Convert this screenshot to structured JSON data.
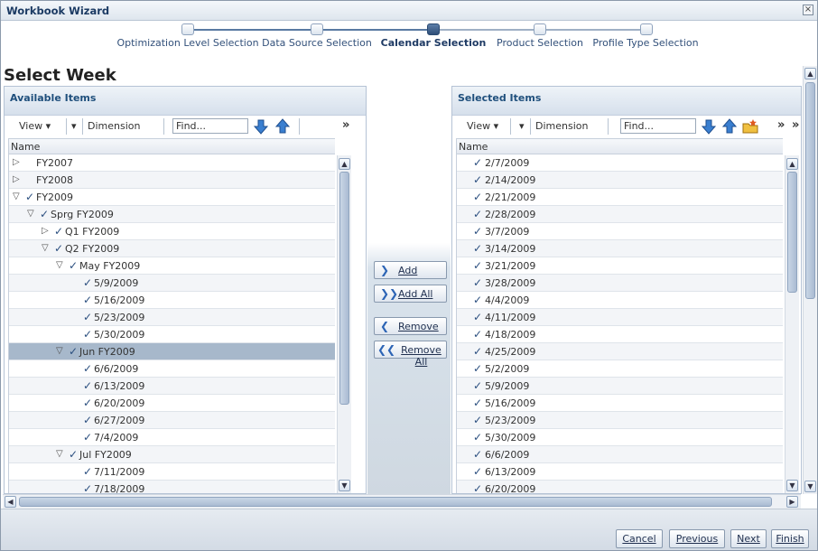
{
  "window": {
    "title": "Workbook Wizard",
    "close_glyph": "×"
  },
  "train": {
    "steps": [
      {
        "label": "Optimization Level Selection"
      },
      {
        "label": "Data Source Selection"
      },
      {
        "label": "Calendar Selection"
      },
      {
        "label": "Product Selection"
      },
      {
        "label": "Profile Type Selection"
      }
    ],
    "current_index": 2
  },
  "page_title": "Select Week",
  "available": {
    "header": "Available Items",
    "toolbar": {
      "view_label": "View ▾",
      "dimension_label": "Dimension",
      "find_placeholder": "Find...",
      "overflow": "»"
    },
    "column_header": "Name",
    "rows": [
      {
        "label": "FY2007",
        "twisty": "▷",
        "checked": false,
        "level": 0
      },
      {
        "label": "FY2008",
        "twisty": "▷",
        "checked": false,
        "level": 0
      },
      {
        "label": "FY2009",
        "twisty": "▽",
        "checked": true,
        "level": 0
      },
      {
        "label": "Sprg FY2009",
        "twisty": "▽",
        "checked": true,
        "level": 1
      },
      {
        "label": "Q1 FY2009",
        "twisty": "▷",
        "checked": true,
        "level": 2
      },
      {
        "label": "Q2 FY2009",
        "twisty": "▽",
        "checked": true,
        "level": 2
      },
      {
        "label": "May FY2009",
        "twisty": "▽",
        "checked": true,
        "level": 3
      },
      {
        "label": "5/9/2009",
        "twisty": "",
        "checked": true,
        "level": 4
      },
      {
        "label": "5/16/2009",
        "twisty": "",
        "checked": true,
        "level": 4
      },
      {
        "label": "5/23/2009",
        "twisty": "",
        "checked": true,
        "level": 4
      },
      {
        "label": "5/30/2009",
        "twisty": "",
        "checked": true,
        "level": 4
      },
      {
        "label": "Jun FY2009",
        "twisty": "▽",
        "checked": true,
        "level": 3,
        "selected": true
      },
      {
        "label": "6/6/2009",
        "twisty": "",
        "checked": true,
        "level": 4
      },
      {
        "label": "6/13/2009",
        "twisty": "",
        "checked": true,
        "level": 4
      },
      {
        "label": "6/20/2009",
        "twisty": "",
        "checked": true,
        "level": 4
      },
      {
        "label": "6/27/2009",
        "twisty": "",
        "checked": true,
        "level": 4
      },
      {
        "label": "7/4/2009",
        "twisty": "",
        "checked": true,
        "level": 4
      },
      {
        "label": "Jul FY2009",
        "twisty": "▽",
        "checked": true,
        "level": 3
      },
      {
        "label": "7/11/2009",
        "twisty": "",
        "checked": true,
        "level": 4
      },
      {
        "label": "7/18/2009",
        "twisty": "",
        "checked": true,
        "level": 4
      }
    ]
  },
  "shuttle": {
    "add": "Add",
    "add_all": "Add All",
    "remove": "Remove",
    "remove_all": "Remove All"
  },
  "selected": {
    "header": "Selected Items",
    "toolbar": {
      "view_label": "View ▾",
      "dimension_label": "Dimension",
      "find_placeholder": "Find...",
      "overflow": "»"
    },
    "column_header": "Name",
    "rows": [
      "2/7/2009",
      "2/14/2009",
      "2/21/2009",
      "2/28/2009",
      "3/7/2009",
      "3/14/2009",
      "3/21/2009",
      "3/28/2009",
      "4/4/2009",
      "4/11/2009",
      "4/18/2009",
      "4/25/2009",
      "5/2/2009",
      "5/9/2009",
      "5/16/2009",
      "5/23/2009",
      "5/30/2009",
      "6/6/2009",
      "6/13/2009",
      "6/20/2009"
    ]
  },
  "footer": {
    "cancel": "Cancel",
    "previous": "Previous",
    "next": "Next",
    "finish": "Finish"
  },
  "colors": {
    "accent": "#1f4f7c",
    "selected_row": "#a7b8cb",
    "check": "#2b4f7f",
    "arrow_blue": "#2c64b5"
  }
}
